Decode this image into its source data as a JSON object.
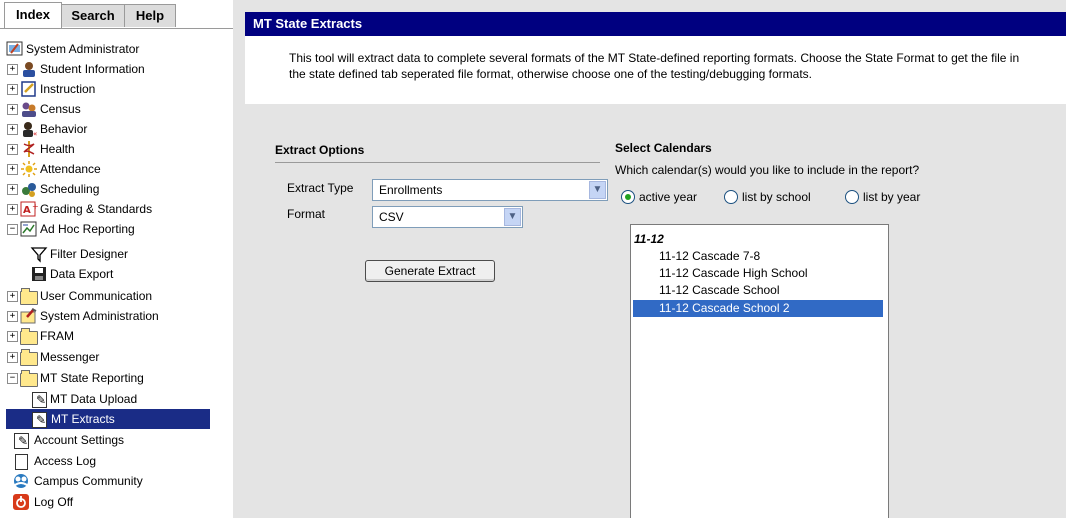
{
  "nav": {
    "tabs": [
      {
        "label": "Index",
        "active": true
      },
      {
        "label": "Search",
        "active": false
      },
      {
        "label": "Help",
        "active": false
      }
    ],
    "tree": [
      {
        "label": "System Administrator",
        "expander": "",
        "icon": "system-administrator-icon"
      },
      {
        "label": "Student Information",
        "expander": "+",
        "icon": "student-information-icon"
      },
      {
        "label": "Instruction",
        "expander": "+",
        "icon": "instruction-icon"
      },
      {
        "label": "Census",
        "expander": "+",
        "icon": "census-icon"
      },
      {
        "label": "Behavior",
        "expander": "+",
        "icon": "behavior-icon"
      },
      {
        "label": "Health",
        "expander": "+",
        "icon": "health-icon"
      },
      {
        "label": "Attendance",
        "expander": "+",
        "icon": "attendance-icon"
      },
      {
        "label": "Scheduling",
        "expander": "+",
        "icon": "scheduling-icon"
      },
      {
        "label": "Grading & Standards",
        "expander": "+",
        "icon": "grading-icon"
      },
      {
        "label": "Ad Hoc Reporting",
        "expander": "−",
        "icon": "ad-hoc-reporting-icon"
      },
      {
        "label": "Filter Designer",
        "expander": "",
        "icon": "filter-icon"
      },
      {
        "label": "Data Export",
        "expander": "",
        "icon": "save-disk-icon"
      },
      {
        "label": "User Communication",
        "expander": "+",
        "icon": "folder-icon"
      },
      {
        "label": "System Administration",
        "expander": "+",
        "icon": "system-administration-icon"
      },
      {
        "label": "FRAM",
        "expander": "+",
        "icon": "folder-icon"
      },
      {
        "label": "Messenger",
        "expander": "+",
        "icon": "folder-icon"
      },
      {
        "label": "MT State Reporting",
        "expander": "−",
        "icon": "folder-open-icon"
      },
      {
        "label": "MT Data Upload",
        "expander": "",
        "icon": "note-icon"
      },
      {
        "label": "MT Extracts",
        "expander": "",
        "icon": "note-icon",
        "selected": true
      },
      {
        "label": "Account Settings",
        "expander": "",
        "icon": "note-icon"
      },
      {
        "label": "Access Log",
        "expander": "",
        "icon": "document-icon"
      },
      {
        "label": "Campus Community",
        "expander": "",
        "icon": "community-icon"
      },
      {
        "label": "Log Off",
        "expander": "",
        "icon": "power-icon"
      }
    ]
  },
  "header": {
    "title": "MT State Extracts",
    "description": "This tool will extract data to complete several formats of the MT State-defined reporting formats. Choose the State Format to get the file in the state defined tab seperated file format, otherwise choose one of the testing/debugging formats."
  },
  "extract_options": {
    "title": "Extract Options",
    "extract_type_label": "Extract Type",
    "extract_type_value": "Enrollments",
    "format_label": "Format",
    "format_value": "CSV",
    "generate_label": "Generate Extract"
  },
  "calendars": {
    "title": "Select Calendars",
    "question": "Which calendar(s) would you like to include in the report?",
    "radios": [
      {
        "label": "active year",
        "checked": true
      },
      {
        "label": "list by school",
        "checked": false
      },
      {
        "label": "list by year",
        "checked": false
      }
    ],
    "group_label": "11-12",
    "options": [
      {
        "label": "11-12 Cascade 7-8",
        "selected": false
      },
      {
        "label": "11-12 Cascade High School",
        "selected": false
      },
      {
        "label": "11-12 Cascade School",
        "selected": false
      },
      {
        "label": "11-12 Cascade School 2",
        "selected": true
      }
    ]
  },
  "colors": {
    "title_bar": "#000080",
    "selected_nav": "#1a2c86",
    "selected_option": "#316ac5",
    "panel_background": "#e4e4e4"
  }
}
